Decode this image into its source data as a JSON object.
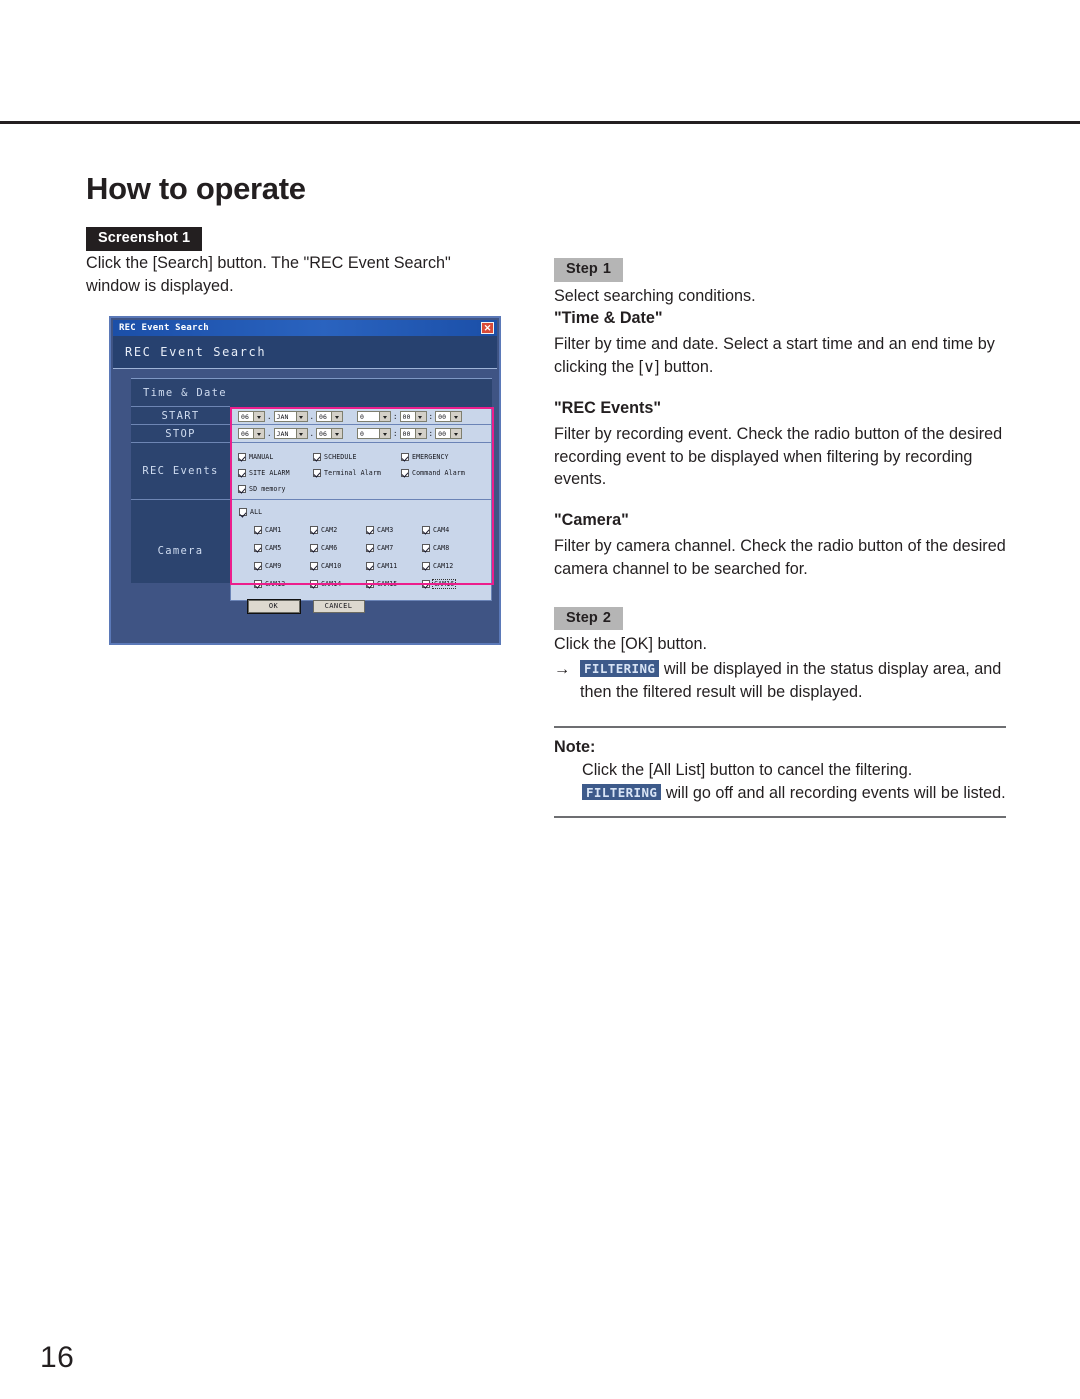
{
  "page": {
    "title": "How to operate",
    "number": "16"
  },
  "screenshot_block": {
    "tag_label": "Screenshot",
    "tag_number": "1",
    "caption": "Click the [Search] button. The \"REC Event Search\" window is displayed."
  },
  "steps": [
    {
      "tag_label": "Step",
      "tag_number": "1",
      "intro": "Select searching conditions.",
      "sections": [
        {
          "heading": "\"Time & Date\"",
          "body": "Filter by time and date. Select a start time and an end time by clicking the [∨] button."
        },
        {
          "heading": "\"REC Events\"",
          "body": "Filter by recording event. Check the radio button of the desired recording event to be displayed when filtering by recording events."
        },
        {
          "heading": "\"Camera\"",
          "body": "Filter by camera channel. Check the radio button of the desired camera channel to be searched for."
        }
      ]
    },
    {
      "tag_label": "Step",
      "tag_number": "2",
      "intro": "Click the [OK] button.",
      "arrow_glyph": "→",
      "arrow_badge": "FILTERING",
      "arrow_text": " will be displayed in the status display area, and then the filtered result will be displayed."
    }
  ],
  "note": {
    "label": "Note:",
    "line1": "Click the [All List] button to cancel the filtering.",
    "badge": "FILTERING",
    "line2": " will go off and all recording events will be listed."
  },
  "dialog": {
    "titlebar_text": "REC Event Search",
    "close_icon": "close-icon",
    "banner_text": "REC Event Search",
    "rows": {
      "time_date_header": "Time & Date",
      "start_label": "START",
      "stop_label": "STOP",
      "rec_events_label": "REC Events",
      "camera_label": "Camera"
    },
    "start_values": {
      "year": "06",
      "month": "JAN",
      "day": "06",
      "hour": "0",
      "minute": "00",
      "second": "00",
      "date_sep": ".",
      "time_sep": ":"
    },
    "stop_values": {
      "year": "06",
      "month": "JAN",
      "day": "06",
      "hour": "0",
      "minute": "00",
      "second": "00",
      "date_sep": ".",
      "time_sep": ":"
    },
    "rec_events": [
      {
        "label": "MANUAL",
        "checked": true
      },
      {
        "label": "SCHEDULE",
        "checked": true
      },
      {
        "label": "EMERGENCY",
        "checked": true
      },
      {
        "label": "SITE ALARM",
        "checked": true
      },
      {
        "label": "Terminal Alarm",
        "checked": true
      },
      {
        "label": "Command Alarm",
        "checked": true
      },
      {
        "label": "SD memory",
        "checked": true
      }
    ],
    "camera_all": {
      "label": "ALL",
      "checked": true
    },
    "cameras": [
      {
        "label": "CAM1",
        "checked": true
      },
      {
        "label": "CAM2",
        "checked": true
      },
      {
        "label": "CAM3",
        "checked": true
      },
      {
        "label": "CAM4",
        "checked": true
      },
      {
        "label": "CAM5",
        "checked": true
      },
      {
        "label": "CAM6",
        "checked": true
      },
      {
        "label": "CAM7",
        "checked": true
      },
      {
        "label": "CAM8",
        "checked": true
      },
      {
        "label": "CAM9",
        "checked": true
      },
      {
        "label": "CAM10",
        "checked": true
      },
      {
        "label": "CAM11",
        "checked": true
      },
      {
        "label": "CAM12",
        "checked": true
      },
      {
        "label": "CAM13",
        "checked": true
      },
      {
        "label": "CAM14",
        "checked": true
      },
      {
        "label": "CAM15",
        "checked": true
      },
      {
        "label": "CAM16",
        "checked": true,
        "focused": true
      }
    ],
    "buttons": {
      "ok": "OK",
      "cancel": "CANCEL"
    },
    "colors": {
      "highlight_outline": "#ec1e8c",
      "titlebar": "#2a63bf",
      "dialog_bg": "#3f5484",
      "field_bg": "#c9d6ea",
      "close_button": "#d94b38"
    }
  }
}
